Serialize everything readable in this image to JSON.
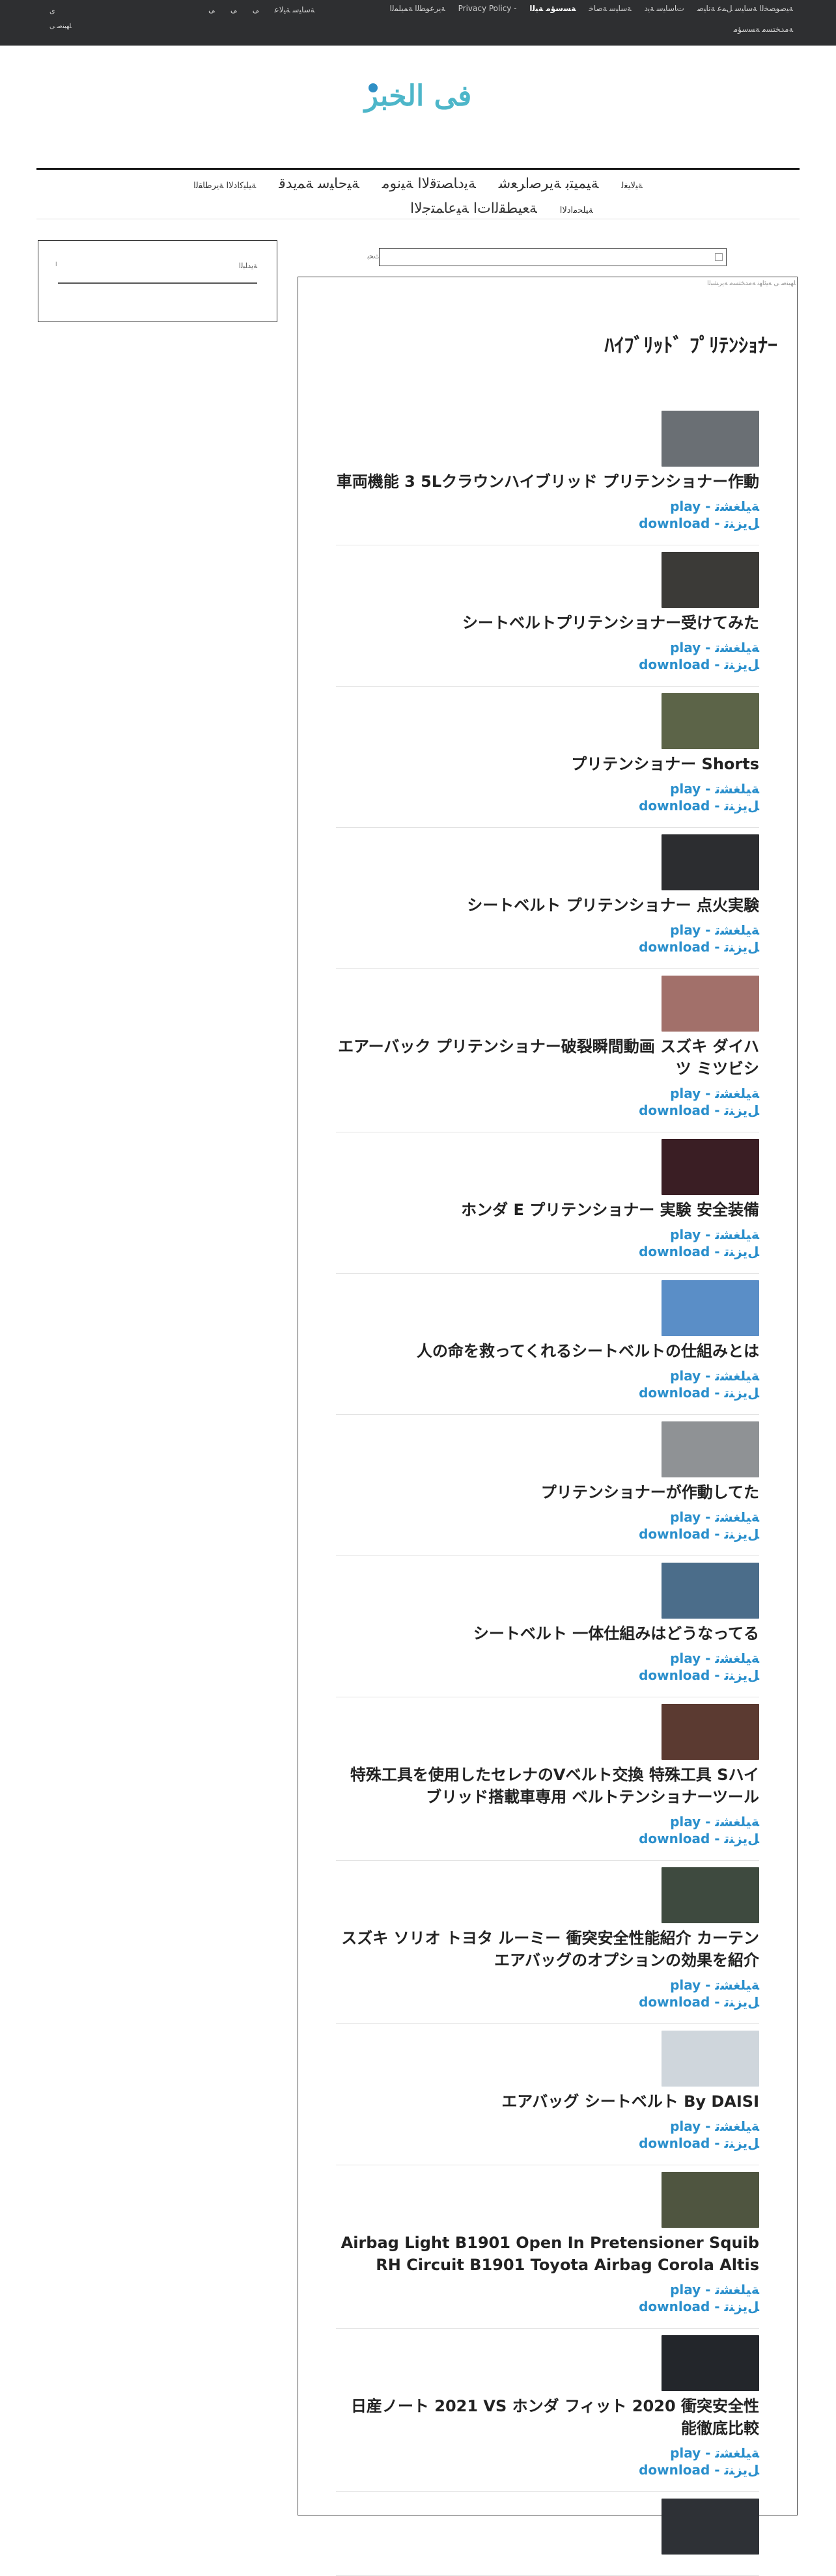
{
  "topbar": {
    "left_main": "ى",
    "left_sub": "ﺎﻬﺒﻨﺻ ﻰ",
    "center": [
      "ﺔﺳﺎﻴﺳ ﺔﻴﻟﺎﻋ",
      "ﻰ",
      "ﻰ",
      "ﻰ"
    ],
    "right": [
      "ﺔﺳﺎﻴﺳ ﺔﺻﺎﺧ",
      "ﺕﺎﺳﺎﻴﺳ ﺔﻳﺩ",
      "ﻞﻤﻋ ﺔﻧﺎﻴﺻ",
      "Privacy Policy - ﺔﻴﺻﻮﺼﺨﻟﺍ ﺔﺳﺎﻴﺳ",
      "ﺔﻳﺮﻋﻮﻄﻟﺍ ﺔﻤﻴﻠﻤﻟﺍ"
    ],
    "right_active": "ﺔﺴﺳﺆﻣ ﺔﻴﻟﺍ",
    "right_row2": "ﺔﻣﺪﺨﺘﺴﻣ ﺔﺴﺳﺆﻣ"
  },
  "logo": {
    "text": "فى الخبر"
  },
  "nav": {
    "row1": [
      "ﺔﻴﻟﺎﻴﻐﻟ",
      "ﺔﻴﻤﻴﺘﺑ ﺔﻳﺮﺻﺍﺮﻌﺷ",
      "ﺔﻳﺩﺎﺼﺘﻗﻻﺍ ﺔﻴﻧﻮﻣ",
      "ﺔﻴﺣﺎﻴﺳ ﺔﻤﻳﺪﻗ",
      "ﺔﻴﻠﻴﻛﺍﺩﻻﺍ ﺔﻳﺮﻃﺎﻘﻟﺍ"
    ],
    "row2": [
      "ﺔﻴﻠﺤﻣﺍﺩﻻﺍ",
      "ﺔﻌﻴﻄﻘﻟﺍﺕﺍ ﺔﻴﻋﺎﻤﺘﺟﻻﺍ"
    ]
  },
  "sidebar": {
    "label": "ﺔﻳﺪﻠﺒﻟﺍ",
    "mini": "ﺍ"
  },
  "search": {
    "label": "ﺚﺤﺑ",
    "placeholder": ""
  },
  "main": {
    "breadcrumb": "ﺎﻬﺒﻨﺻ ﻰ ﺔﻴﺋﺎﻬﻧ ﺔﻣﺪﺨﺘﺴﻣ ﺔﻳﺮﺸﺒﻟﺍ",
    "title": "ﾊｲﾌﾞﾘｯﾄﾞ ﾌﾟﾘﾃﾝｼｮﾅｰ"
  },
  "video_items": [
    {
      "title": "車両機能 3 5Lクラウンハイブリッド プリテンショナー作動",
      "play": "play - ﺔﻴﻠﻐﺸﺗ",
      "download": "download - ﻞﻳﺰﻨﺗ",
      "thumb_color": "#6a6f74"
    },
    {
      "title": "シートベルトプリテンショナー受けてみた",
      "play": "play - ﺔﻴﻠﻐﺸﺗ",
      "download": "download - ﻞﻳﺰﻨﺗ",
      "thumb_color": "#3b3a37"
    },
    {
      "title": "プリテンショナー Shorts",
      "play": "play - ﺔﻴﻠﻐﺸﺗ",
      "download": "download - ﻞﻳﺰﻨﺗ",
      "thumb_color": "#5c6448"
    },
    {
      "title": "シートベルト プリテンショナー 点火実験",
      "play": "play - ﺔﻴﻠﻐﺸﺗ",
      "download": "download - ﻞﻳﺰﻨﺗ",
      "thumb_color": "#2c2d30"
    },
    {
      "title": "エアーバック プリテンショナー破裂瞬間動画 スズキ ダイハツ ミツビシ",
      "play": "play - ﺔﻴﻠﻐﺸﺗ",
      "download": "download - ﻞﻳﺰﻨﺗ",
      "thumb_color": "#a2706a"
    },
    {
      "title": "ホンダ E プリテンショナー 実験 安全装備",
      "play": "play - ﺔﻴﻠﻐﺸﺗ",
      "download": "download - ﻞﻳﺰﻨﺗ",
      "thumb_color": "#3a1e24"
    },
    {
      "title": "人の命を救ってくれるシートベルトの仕組みとは",
      "play": "play - ﺔﻴﻠﻐﺸﺗ",
      "download": "download - ﻞﻳﺰﻨﺗ",
      "thumb_color": "#5a8ec7"
    },
    {
      "title": "プリテンショナーが作動してた",
      "play": "play - ﺔﻴﻠﻐﺸﺗ",
      "download": "download - ﻞﻳﺰﻨﺗ",
      "thumb_color": "#8f9295"
    },
    {
      "title": "シートベルト 一体仕組みはどうなってる",
      "play": "play - ﺔﻴﻠﻐﺸﺗ",
      "download": "download - ﻞﻳﺰﻨﺗ",
      "thumb_color": "#4b6d8a"
    },
    {
      "title": "特殊工具を使用したセレナのVベルト交換 特殊工具 Sハイブリッド搭載車専用 ベルトテンショナーツール",
      "play": "play - ﺔﻴﻠﻐﺸﺗ",
      "download": "download - ﻞﻳﺰﻨﺗ",
      "thumb_color": "#5b3a31"
    },
    {
      "title": "スズキ ソリオ トヨタ ルーミー 衝突安全性能紹介 カーテンエアバッグのオプションの効果を紹介",
      "play": "play - ﺔﻴﻠﻐﺸﺗ",
      "download": "download - ﻞﻳﺰﻨﺗ",
      "thumb_color": "#3e4a3f"
    },
    {
      "title": "エアバッグ シートベルト By DAISI",
      "play": "play - ﺔﻴﻠﻐﺸﺗ",
      "download": "download - ﻞﻳﺰﻨﺗ",
      "thumb_color": "#cfd6dc"
    },
    {
      "title": "Airbag Light B1901 Open In Pretensioner Squib RH Circuit B1901 Toyota Airbag Corola Altis",
      "play": "play - ﺔﻴﻠﻐﺸﺗ",
      "download": "download - ﻞﻳﺰﻨﺗ",
      "thumb_color": "#4f5540"
    },
    {
      "title": "日産ノート 2021 VS ホンダ フィット 2020 衝突安全性能徹底比較",
      "play": "play - ﺔﻴﻠﻐﺸﺗ",
      "download": "download - ﻞﻳﺰﻨﺗ",
      "thumb_color": "#23262b"
    },
    {
      "title": "",
      "play": "",
      "download": "",
      "thumb_color": "#2e3136"
    }
  ]
}
